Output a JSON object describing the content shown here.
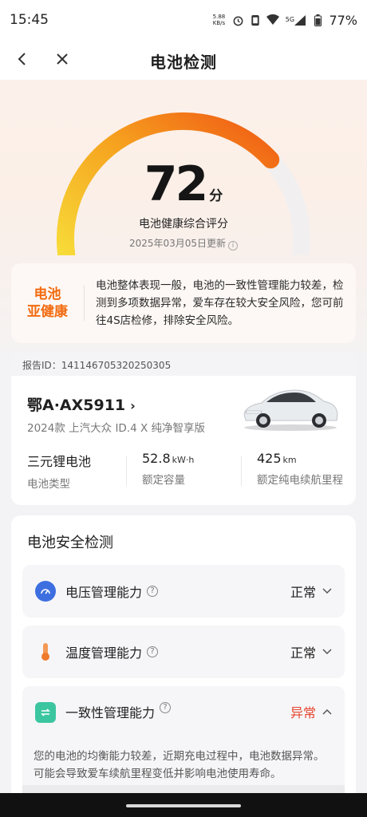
{
  "status_bar": {
    "time": "15:45",
    "net_speed_value": "5.88",
    "net_speed_unit": "KB/s",
    "network": "5G",
    "battery": "77%"
  },
  "nav": {
    "title": "电池检测",
    "back_icon": "chevron-left-icon",
    "close_icon": "close-icon"
  },
  "gauge": {
    "score": "72",
    "score_unit": "分",
    "score_value": 72,
    "score_max": 100,
    "caption": "电池健康综合评分",
    "updated": "2025年03月05日更新",
    "colors": {
      "start": "#f7e23b",
      "mid": "#f6a21f",
      "end": "#f05a14",
      "track": "#f1efef"
    }
  },
  "health": {
    "badge_line1": "电池",
    "badge_line2": "亚健康",
    "description": "电池整体表现一般，电池的一致性管理能力较差，检测到多项数据异常，爱车存在较大安全风险，您可前往4S店检修，排除安全风险。"
  },
  "vehicle": {
    "report_id": "报告ID：141146705320250305",
    "plate": "鄂A·AX5911",
    "model": "2024款 上汽大众 ID.4 X   纯净智享版",
    "specs": [
      {
        "value": "三元锂电池",
        "unit": "",
        "label": "电池类型"
      },
      {
        "value": "52.8",
        "unit": "kW·h",
        "label": "额定容量"
      },
      {
        "value": "425",
        "unit": "km",
        "label": "额定纯电续航里程"
      }
    ]
  },
  "safety": {
    "title": "电池安全检测",
    "items": [
      {
        "label": "电压管理能力",
        "status": "正常",
        "icon": "gauge-icon"
      },
      {
        "label": "温度管理能力",
        "status": "正常",
        "icon": "thermometer-icon"
      },
      {
        "label": "一致性管理能力",
        "status": "异常",
        "icon": "balance-icon",
        "description": "您的电池的均衡能力较差，近期充电过程中，电池数据异常。可能会导致爱车续航里程变低并影响电池使用寿命。"
      }
    ],
    "colors": {
      "normal": "#1f1f1f",
      "abnormal": "#e6452e"
    }
  }
}
